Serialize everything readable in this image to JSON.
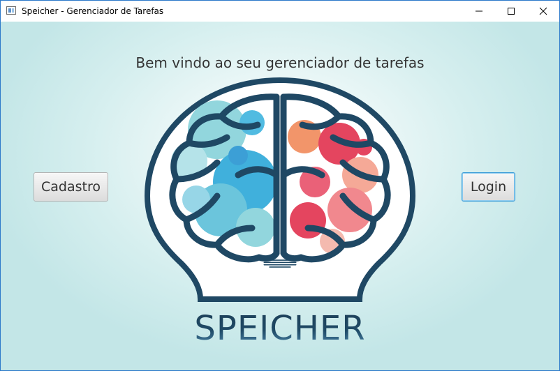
{
  "window": {
    "title": "Speicher - Gerenciador de Tarefas",
    "controls": {
      "minimize": "minimize",
      "maximize": "maximize",
      "close": "close"
    }
  },
  "main": {
    "welcome_text": "Bem vindo ao seu gerenciador de tarefas",
    "cadastro_label": "Cadastro",
    "login_label": "Login",
    "brand_name": "SPEICHER",
    "logo_icon": "brain-lightbulb-logo"
  },
  "colors": {
    "bulb_stroke": "#1f4864",
    "left_brain": "#2aa6d6",
    "right_brain": "#e2314e",
    "background": "#d6efef",
    "focus_border": "#3a9cd8"
  }
}
